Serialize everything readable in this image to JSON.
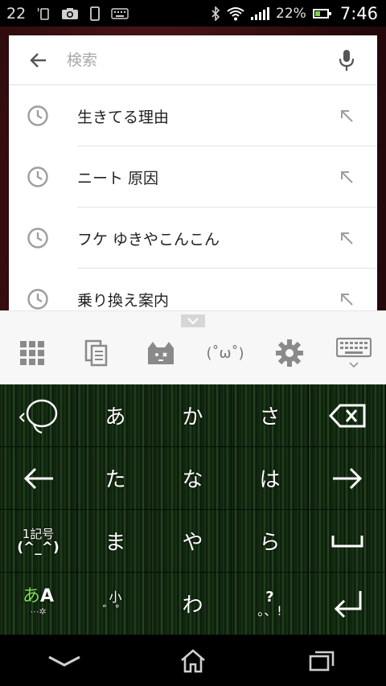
{
  "status_bar": {
    "notification_count": "22",
    "battery_percent": "22%",
    "time": "7:46"
  },
  "search": {
    "placeholder": "検索",
    "value": ""
  },
  "suggestions": [
    {
      "text": "生きてる理由"
    },
    {
      "text": "ニート 原因"
    },
    {
      "text": "フケ ゆきやこんこん"
    },
    {
      "text": "乗り換え案内"
    }
  ],
  "keyboard": {
    "toolbar": {
      "kaomoji_label": "(˚ω˚)"
    },
    "keys": {
      "r1": [
        "あ",
        "か",
        "さ"
      ],
      "r2": [
        "た",
        "な",
        "は"
      ],
      "r3": [
        "ま",
        "や",
        "ら"
      ],
      "r4_middle": [
        "わ"
      ],
      "symbol_key_top": "1記号",
      "symbol_key_bottom": "(^_^)",
      "mode_key_hira": "あ",
      "mode_key_alpha": "A",
      "small_key_top": "小",
      "small_key_bottom": "゛゜",
      "punct_key_top": "?",
      "punct_key_bottom": "。、!"
    }
  },
  "colors": {
    "accent_green": "#7be05a",
    "keyboard_bg": "#1c3a18",
    "card_bg": "#ffffff"
  }
}
